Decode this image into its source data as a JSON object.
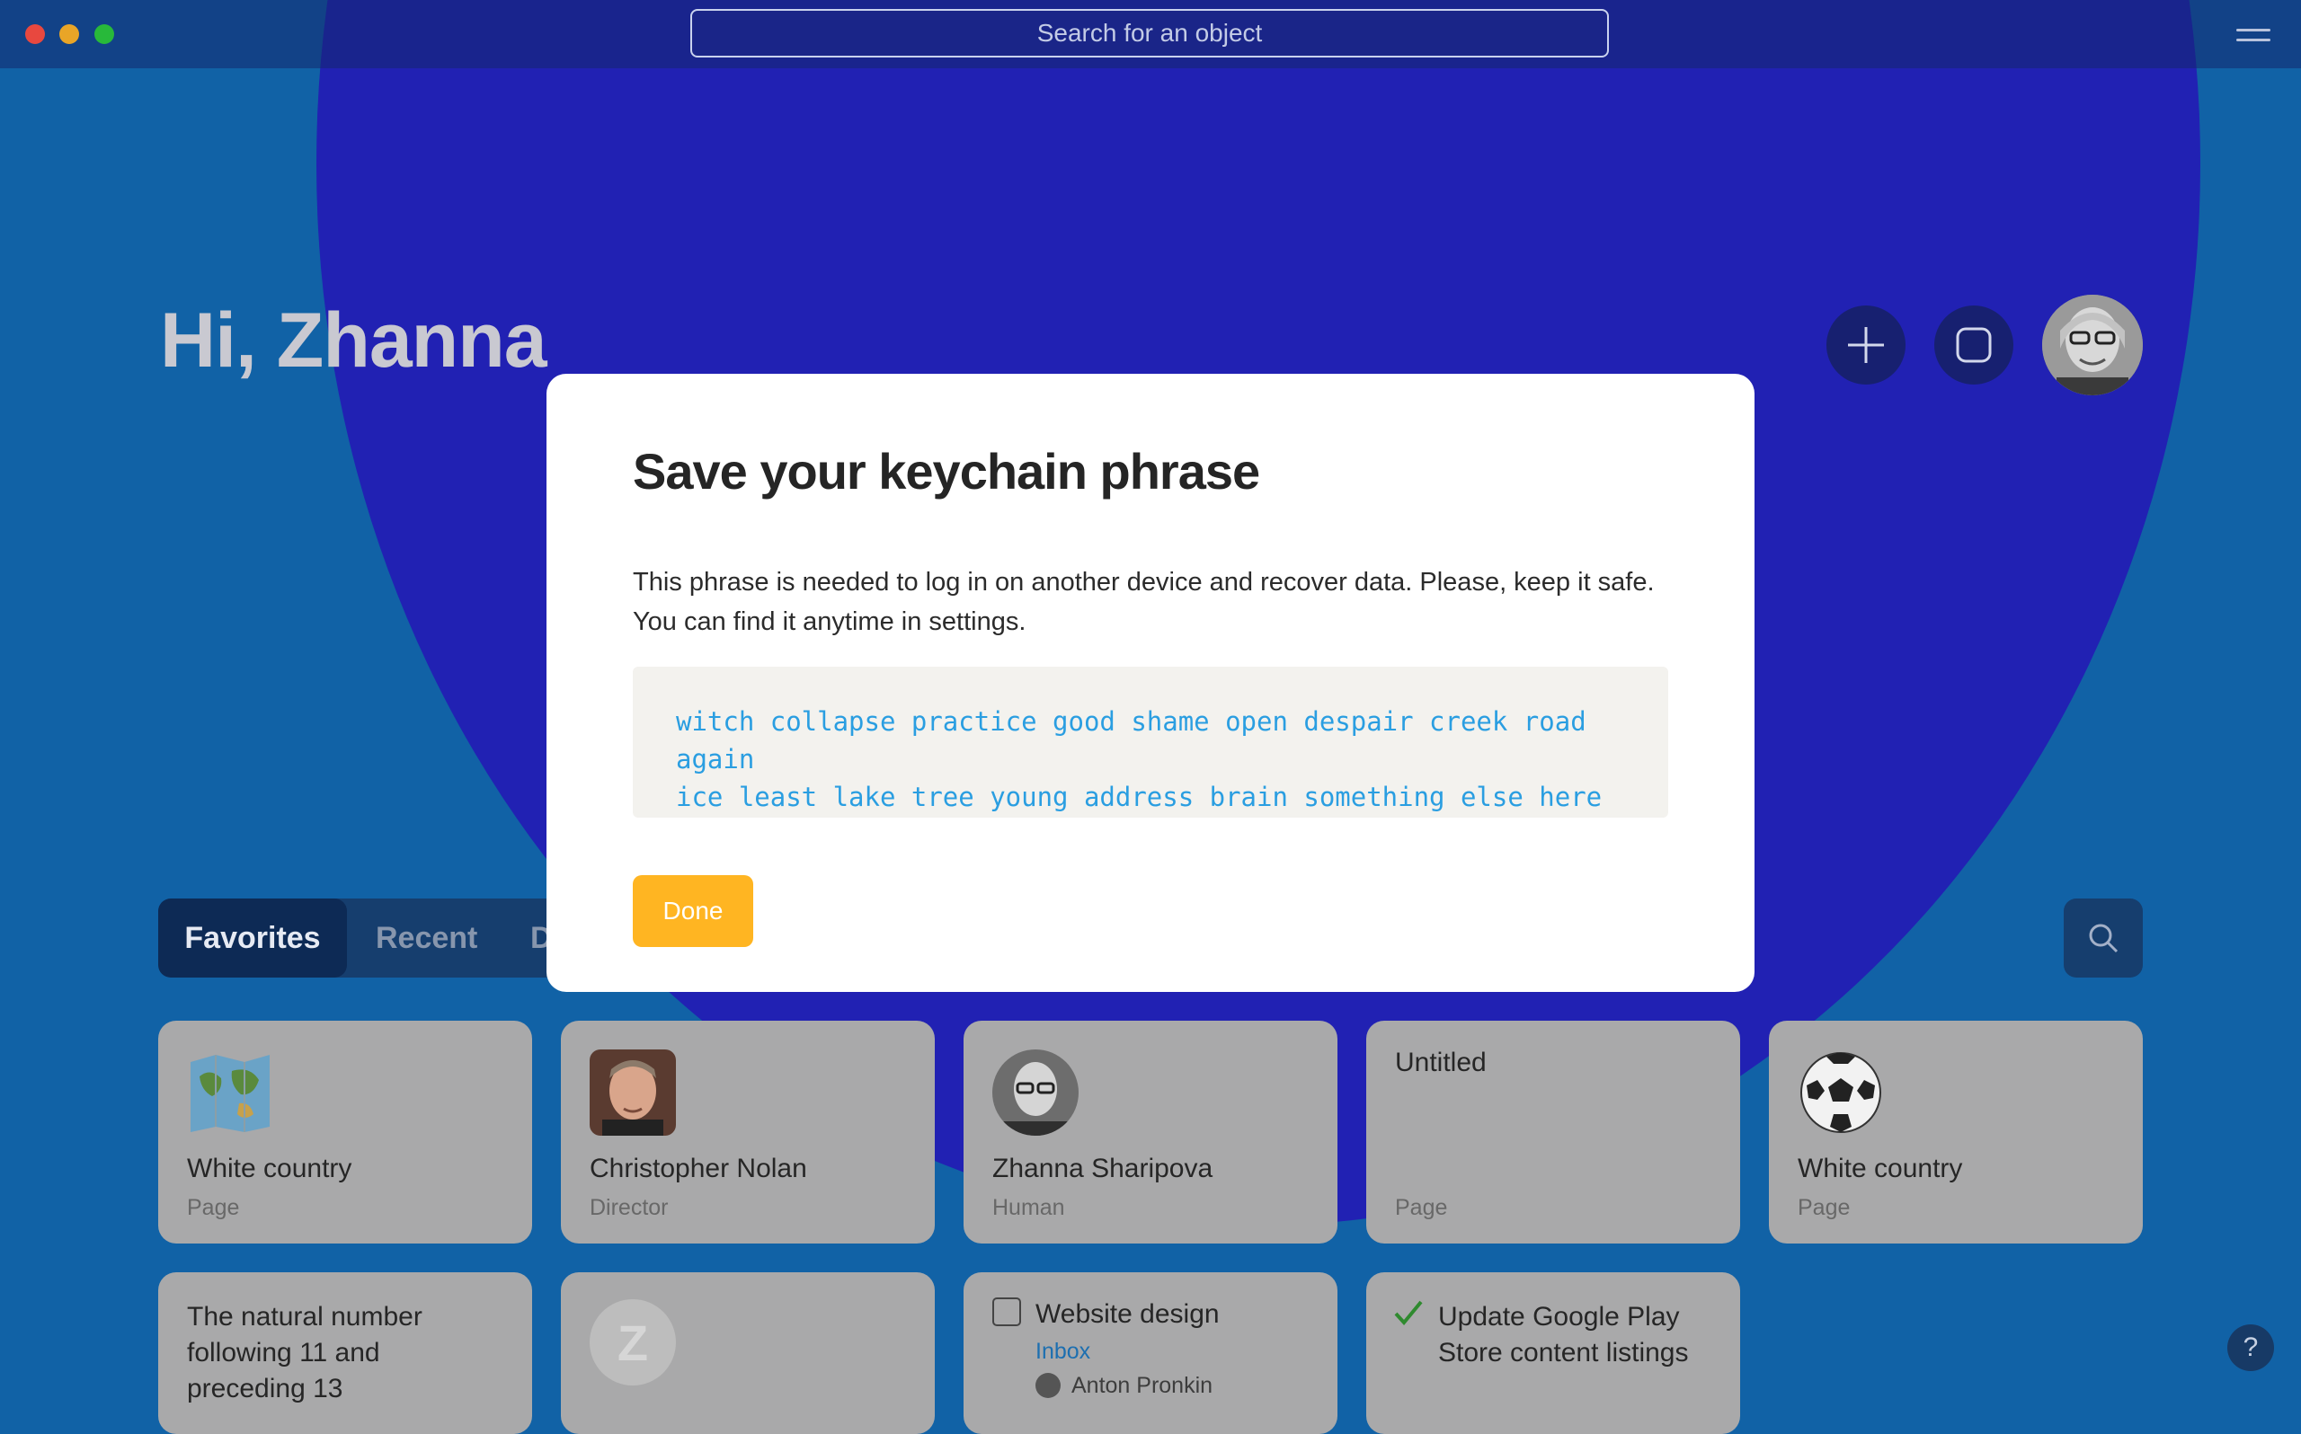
{
  "topbar": {
    "search_placeholder": "Search for an object",
    "traffic_lights": [
      "#e8483f",
      "#e9a527",
      "#28b93a"
    ]
  },
  "home": {
    "greeting": "Hi, Zhanna",
    "tabs": [
      {
        "label": "Favorites",
        "active": true
      },
      {
        "label": "Recent",
        "active": false
      },
      {
        "label": "D",
        "active": false
      }
    ]
  },
  "cards_row1": [
    {
      "title": "White country",
      "subtitle": "Page",
      "icon": "world-map-icon"
    },
    {
      "title": "Christopher Nolan",
      "subtitle": "Director",
      "icon": "portrait-photo"
    },
    {
      "title": "Zhanna Sharipova",
      "subtitle": "Human",
      "icon": "portrait-photo-round"
    },
    {
      "title": "Untitled",
      "subtitle": "Page",
      "icon": ""
    },
    {
      "title": "White country",
      "subtitle": "Page",
      "icon": "soccer-ball-icon"
    }
  ],
  "cards_row2": [
    {
      "title": "The natural number following 11 and preceding 13"
    },
    {
      "initial": "Z"
    },
    {
      "title": "Website design",
      "subtitle": "Inbox",
      "assignee": "Anton Pronkin",
      "icon": "checkbox-icon"
    },
    {
      "title": "Update Google Play Store content listings",
      "icon": "checkmark-icon"
    }
  ],
  "modal": {
    "title": "Save your keychain phrase",
    "description_line1": "This phrase is needed to log in on another device and recover data. Please, keep it safe.",
    "description_line2": "You can find it anytime in settings.",
    "phrase_line1": "witch collapse practice good shame open despair creek road again",
    "phrase_line2": "ice least lake tree young address brain something else here",
    "done_label": "Done"
  },
  "help": {
    "label": "?"
  },
  "colors": {
    "background": "#1162a6",
    "circle": "#2121b3",
    "accent_button": "#ffb522",
    "phrase_text": "#2a9ee1"
  }
}
